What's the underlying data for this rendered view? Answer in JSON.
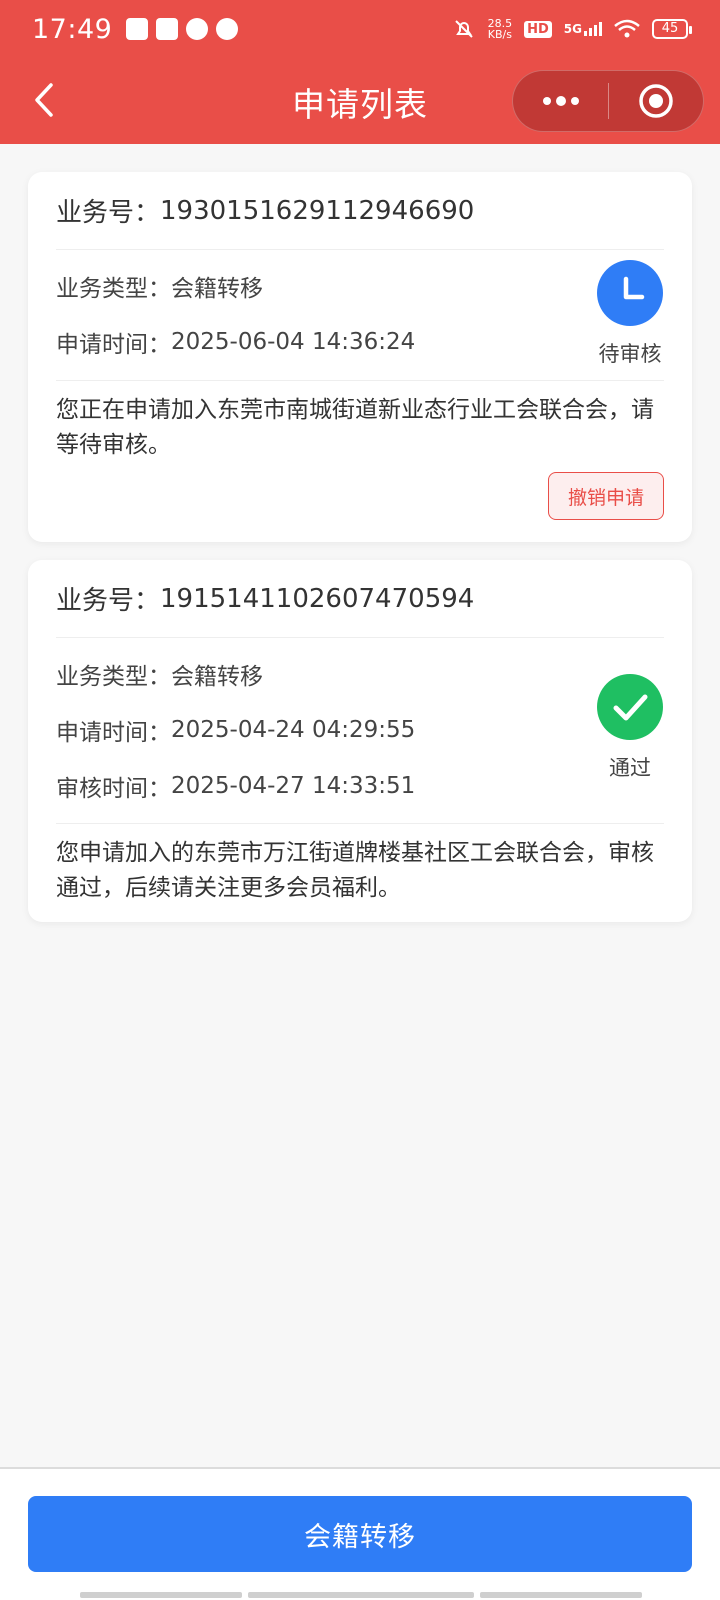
{
  "status_bar": {
    "time": "17:49",
    "net_speed_value": "28.5",
    "net_speed_unit": "KB/s",
    "hd_label": "HD",
    "network_type": "5G",
    "battery": "45"
  },
  "nav": {
    "title": "申请列表"
  },
  "applications": [
    {
      "biz_label": "业务号：",
      "biz_no": "1930151629112946690",
      "type_label": "业务类型：",
      "type_value": "会籍转移",
      "apply_time_label": "申请时间：",
      "apply_time": "2025-06-04 14:36:24",
      "status": "待审核",
      "status_color": "#2f7df6",
      "description": "您正在申请加入东莞市南城街道新业态行业工会联合会，请等待审核。",
      "action_label": "撤销申请"
    },
    {
      "biz_label": "业务号：",
      "biz_no": "1915141102607470594",
      "type_label": "业务类型：",
      "type_value": "会籍转移",
      "apply_time_label": "申请时间：",
      "apply_time": "2025-04-24 04:29:55",
      "review_time_label": "审核时间：",
      "review_time": "2025-04-27 14:33:51",
      "status": "通过",
      "status_color": "#1fbf62",
      "description": "您申请加入的东莞市万江街道牌楼基社区工会联合会，审核通过，后续请关注更多会员福利。"
    }
  ],
  "bottom": {
    "primary_label": "会籍转移"
  },
  "colors": {
    "header": "#e94e48",
    "primary": "#2f7df6",
    "success": "#1fbf62"
  }
}
